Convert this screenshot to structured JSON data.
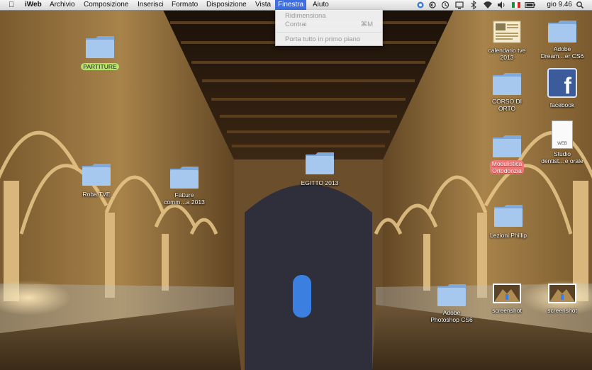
{
  "menubar": {
    "app_name": "iWeb",
    "menus": [
      "Archivio",
      "Composizione",
      "Inserisci",
      "Formato",
      "Disposizione",
      "Vista",
      "Finestra",
      "Aiuto"
    ],
    "active_menu": "Finestra",
    "clock": "gio 9.46",
    "status_icons": [
      "dropbox-icon",
      "sync-icon",
      "time-machine-icon",
      "display-icon",
      "bluetooth-icon",
      "wifi-icon",
      "volume-icon",
      "italian-flag-icon",
      "battery-icon",
      "spotlight-icon"
    ]
  },
  "window_menu": {
    "items": [
      {
        "label": "Ridimensiona",
        "shortcut": ""
      },
      {
        "label": "Contrai",
        "shortcut": "⌘M"
      },
      {
        "label": "Porta tutto in primo piano",
        "shortcut": ""
      }
    ]
  },
  "desktop": {
    "icons": [
      {
        "id": "partiture",
        "label": "PARTITURE",
        "kind": "folder",
        "tag": "green"
      },
      {
        "id": "roba-tve",
        "label": "Roba TVE",
        "kind": "folder",
        "tag": ""
      },
      {
        "id": "fatture",
        "label": "Fatture\ncomm…a 2013",
        "kind": "folder",
        "tag": ""
      },
      {
        "id": "egitto",
        "label": "EGITTO 2013",
        "kind": "folder",
        "tag": ""
      },
      {
        "id": "calendario",
        "label": "calendario tve\n2013",
        "kind": "document",
        "tag": ""
      },
      {
        "id": "adobe-dream",
        "label": "Adobe\nDream…er CS6",
        "kind": "folder",
        "tag": ""
      },
      {
        "id": "corso-orto",
        "label": "CORSO DI\nORTO",
        "kind": "folder",
        "tag": ""
      },
      {
        "id": "facebook",
        "label": "facebook",
        "kind": "facebook",
        "tag": ""
      },
      {
        "id": "modulistica",
        "label": "Modulistica\nOrtodonzia",
        "kind": "folder",
        "tag": "red"
      },
      {
        "id": "studio",
        "label": "Studio\ndentist…e orale",
        "kind": "webloc",
        "tag": ""
      },
      {
        "id": "lezioni",
        "label": "Lezioni Phillip",
        "kind": "folder",
        "tag": ""
      },
      {
        "id": "photoshop",
        "label": "Adobe\nPhotoshop CS6",
        "kind": "folder",
        "tag": ""
      },
      {
        "id": "screenshot1",
        "label": "screenshot",
        "kind": "image",
        "tag": ""
      },
      {
        "id": "screenshot2",
        "label": "screenshot",
        "kind": "image",
        "tag": ""
      }
    ],
    "webloc_badge": "WEB",
    "facebook_glyph": "f"
  },
  "colors": {
    "menu_highlight": "#3f6ee0",
    "folder_blue": "#8fb9e6",
    "tag_green": "#b6e36a",
    "tag_red": "#f07575"
  }
}
